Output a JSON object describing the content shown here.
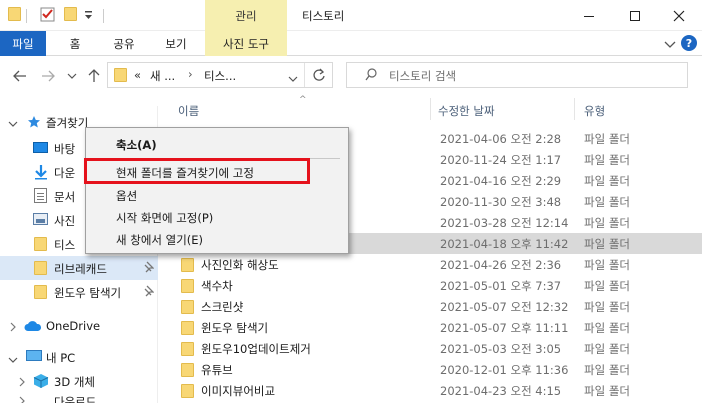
{
  "titlebar": {
    "title": "티스토리",
    "context_tab": "관리",
    "controls": [
      "minimize-icon",
      "maximize-icon",
      "close-icon"
    ]
  },
  "ribbon": {
    "tabs": [
      {
        "label": "파일"
      },
      {
        "label": "홈"
      },
      {
        "label": "공유"
      },
      {
        "label": "보기"
      },
      {
        "label": "사진 도구"
      }
    ]
  },
  "address": {
    "prefix": "«",
    "segments": [
      "새 ...",
      "티스..."
    ],
    "search_placeholder": "티스토리 검색"
  },
  "navpane": {
    "quick_access": "즐겨찾기",
    "items": [
      {
        "label": "바탕",
        "icon": "desktop-icon"
      },
      {
        "label": "다운",
        "icon": "download-icon"
      },
      {
        "label": "문서",
        "icon": "document-icon"
      },
      {
        "label": "사진",
        "icon": "pictures-icon"
      },
      {
        "label": "티스",
        "icon": "folder-icon"
      },
      {
        "label": "리브레캐드",
        "icon": "folder-icon",
        "pinned": true,
        "selected": true
      },
      {
        "label": "윈도우 탐색기",
        "icon": "folder-icon",
        "pinned": true
      }
    ],
    "onedrive": "OneDrive",
    "thispc": "내 PC",
    "objects3d": "3D 개체",
    "next_partial": "다운로드"
  },
  "columns": {
    "name": "이름",
    "date": "수정한 날짜",
    "type": "유형"
  },
  "files": [
    {
      "name": "",
      "date": "2021-04-06 오전 2:28",
      "type": "파일 폴더"
    },
    {
      "name": "",
      "date": "2020-11-24 오전 1:17",
      "type": "파일 폴더"
    },
    {
      "name": "",
      "date": "2021-04-16 오전 2:29",
      "type": "파일 폴더"
    },
    {
      "name": "",
      "date": "2020-11-30 오전 3:48",
      "type": "파일 폴더"
    },
    {
      "name": "",
      "date": "2021-03-28 오전 12:14",
      "type": "파일 폴더"
    },
    {
      "name": "",
      "date": "2021-04-18 오후 11:42",
      "type": "파일 폴더",
      "selected": true
    },
    {
      "name": "사진인화 해상도",
      "date": "2021-04-26 오전 2:36",
      "type": "파일 폴더"
    },
    {
      "name": "색수차",
      "date": "2021-05-01 오후 7:37",
      "type": "파일 폴더"
    },
    {
      "name": "스크린샷",
      "date": "2021-05-07 오전 12:32",
      "type": "파일 폴더"
    },
    {
      "name": "윈도우 탐색기",
      "date": "2021-05-07 오후 11:11",
      "type": "파일 폴더"
    },
    {
      "name": "윈도우10업데이트제거",
      "date": "2021-05-03 오전 3:05",
      "type": "파일 폴더"
    },
    {
      "name": "유튜브",
      "date": "2020-12-01 오후 11:36",
      "type": "파일 폴더"
    },
    {
      "name": "이미지뷰어비교",
      "date": "2021-04-23 오전 4:15",
      "type": "파일 폴더"
    }
  ],
  "context_menu": {
    "items": [
      {
        "label": "축소(A)",
        "bold": true
      },
      {
        "label": "현재 폴더를 즐겨찾기에 고정",
        "highlighted": true
      },
      {
        "label": "옵션"
      },
      {
        "label": "시작 화면에 고정(P)"
      },
      {
        "label": "새 창에서 열기(E)"
      }
    ]
  },
  "colors": {
    "file_tab": "#1c66c2",
    "context_tab": "#f6efb0",
    "highlight_box": "#e5121c",
    "selection": "#dbe8f7"
  }
}
